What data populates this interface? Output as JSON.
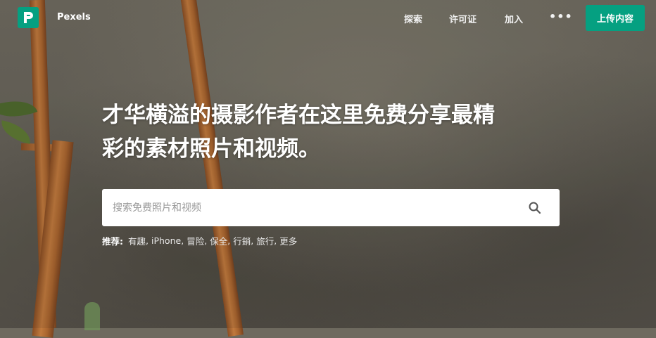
{
  "brand": {
    "name": "Pexels",
    "logo_color": "#05a081"
  },
  "nav": {
    "items": [
      "探索",
      "许可证",
      "加入"
    ],
    "more_label": "•••",
    "upload_label": "上传内容"
  },
  "hero": {
    "title_line1": "才华横溢的摄影作者在这里免费分享最精",
    "title_line2": "彩的素材照片和视频。"
  },
  "search": {
    "placeholder": "搜索免费照片和视频",
    "icon": "search-icon"
  },
  "suggestions": {
    "label": "推荐:",
    "items": [
      "有趣",
      "iPhone",
      "冒险",
      "保全",
      "行銷",
      "旅行",
      "更多"
    ]
  },
  "colors": {
    "accent": "#05a081",
    "text": "#ffffff"
  }
}
